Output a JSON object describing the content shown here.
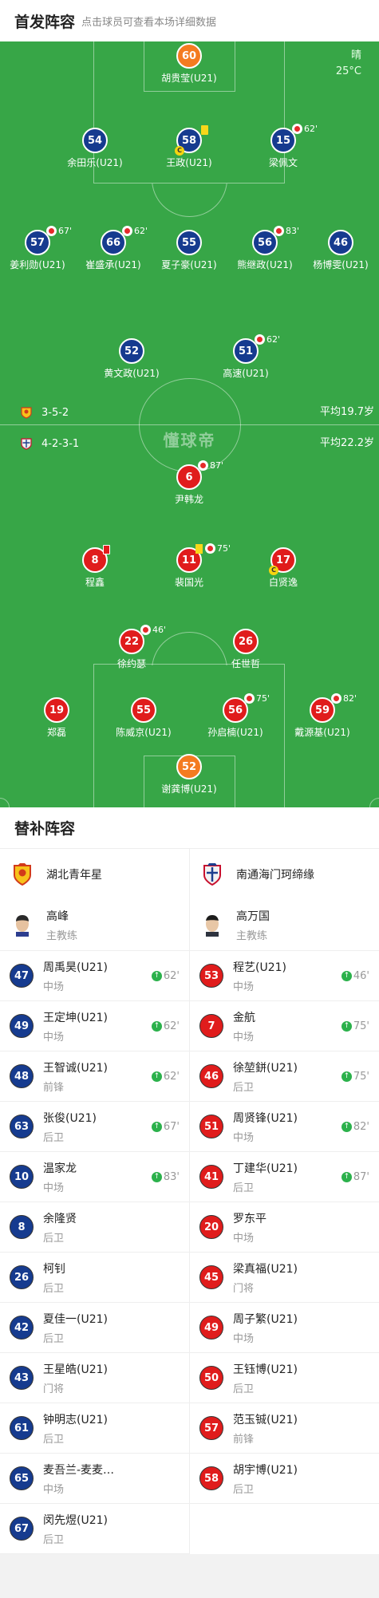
{
  "header": {
    "title": "首发阵容",
    "subtitle": "点击球员可查看本场详细数据"
  },
  "weather": {
    "condition": "晴",
    "temperature": "25°C"
  },
  "watermark": "懂球帝",
  "home_info": {
    "formation": "3-5-2",
    "avg_age": "平均19.7岁"
  },
  "away_info": {
    "formation": "4-2-3-1",
    "avg_age": "平均22.2岁"
  },
  "colors": {
    "pitch": "#37a647",
    "home": "#163b8f",
    "away": "#e01c1c",
    "goalkeeper": "#f47b20",
    "sub_on": "#2bb14b"
  },
  "pitch_players": {
    "p1": {
      "number": "60",
      "name": "胡贵莹(U21)"
    },
    "p2": {
      "number": "54",
      "name": "余田乐(U21)"
    },
    "p3": {
      "number": "58",
      "name": "王政(U21)"
    },
    "p4": {
      "number": "15",
      "name": "梁佩文",
      "sub_minute": "62'"
    },
    "p5": {
      "number": "57",
      "name": "姜利勋(U21)",
      "sub_minute": "67'"
    },
    "p6": {
      "number": "66",
      "name": "崔盛承(U21)",
      "sub_minute": "62'"
    },
    "p7": {
      "number": "55",
      "name": "夏子豪(U21)"
    },
    "p8": {
      "number": "56",
      "name": "熊继政(U21)",
      "sub_minute": "83'"
    },
    "p9": {
      "number": "46",
      "name": "杨博雯(U21)"
    },
    "p10": {
      "number": "52",
      "name": "黄文政(U21)"
    },
    "p11": {
      "number": "51",
      "name": "高速(U21)",
      "sub_minute": "62'"
    },
    "a1": {
      "number": "6",
      "name": "尹韩龙",
      "sub_minute": "87'"
    },
    "a2": {
      "number": "8",
      "name": "程鑫"
    },
    "a3": {
      "number": "11",
      "name": "裴国光",
      "sub_minute": "75'"
    },
    "a4": {
      "number": "17",
      "name": "白贤逸"
    },
    "a5": {
      "number": "22",
      "name": "徐约瑟",
      "sub_minute": "46'"
    },
    "a6": {
      "number": "26",
      "name": "任世哲"
    },
    "a7": {
      "number": "19",
      "name": "郑磊"
    },
    "a8": {
      "number": "55",
      "name": "陈威京(U21)"
    },
    "a9": {
      "number": "56",
      "name": "孙启楠(U21)",
      "sub_minute": "75'"
    },
    "a10": {
      "number": "59",
      "name": "戴源基(U21)",
      "sub_minute": "82'"
    },
    "a11": {
      "number": "52",
      "name": "谢龚博(U21)"
    }
  },
  "subs": {
    "title": "替补阵容",
    "home": {
      "team": "湖北青年星",
      "coach": "高峰",
      "coach_role": "主教练",
      "players": [
        {
          "number": "47",
          "name": "周禹昊(U21)",
          "pos": "中场",
          "on": "62'"
        },
        {
          "number": "49",
          "name": "王定坤(U21)",
          "pos": "中场",
          "on": "62'"
        },
        {
          "number": "48",
          "name": "王智诚(U21)",
          "pos": "前锋",
          "on": "62'"
        },
        {
          "number": "63",
          "name": "张俊(U21)",
          "pos": "后卫",
          "on": "67'"
        },
        {
          "number": "10",
          "name": "温家龙",
          "pos": "中场",
          "on": "83'"
        },
        {
          "number": "8",
          "name": "余隆贤",
          "pos": "后卫"
        },
        {
          "number": "26",
          "name": "柯钊",
          "pos": "后卫"
        },
        {
          "number": "42",
          "name": "夏佳一(U21)",
          "pos": "后卫"
        },
        {
          "number": "43",
          "name": "王星皓(U21)",
          "pos": "门将"
        },
        {
          "number": "61",
          "name": "钟明志(U21)",
          "pos": "后卫"
        },
        {
          "number": "65",
          "name": "麦吾兰-麦麦…",
          "pos": "中场"
        },
        {
          "number": "67",
          "name": "闵先煜(U21)",
          "pos": "后卫"
        }
      ]
    },
    "away": {
      "team": "南通海门珂缔缘",
      "coach": "高万国",
      "coach_role": "主教练",
      "players": [
        {
          "number": "53",
          "name": "程艺(U21)",
          "pos": "中场",
          "on": "46'"
        },
        {
          "number": "7",
          "name": "金航",
          "pos": "中场",
          "on": "75'"
        },
        {
          "number": "46",
          "name": "徐堃鉼(U21)",
          "pos": "后卫",
          "on": "75'"
        },
        {
          "number": "51",
          "name": "周贤锋(U21)",
          "pos": "中场",
          "on": "82'"
        },
        {
          "number": "41",
          "name": "丁建华(U21)",
          "pos": "后卫",
          "on": "87'"
        },
        {
          "number": "20",
          "name": "罗东平",
          "pos": "中场"
        },
        {
          "number": "45",
          "name": "梁真福(U21)",
          "pos": "门将"
        },
        {
          "number": "49",
          "name": "周子繁(U21)",
          "pos": "中场"
        },
        {
          "number": "50",
          "name": "王钰博(U21)",
          "pos": "后卫"
        },
        {
          "number": "57",
          "name": "范玉铖(U21)",
          "pos": "前锋"
        },
        {
          "number": "58",
          "name": "胡宇博(U21)",
          "pos": "后卫"
        }
      ]
    }
  }
}
